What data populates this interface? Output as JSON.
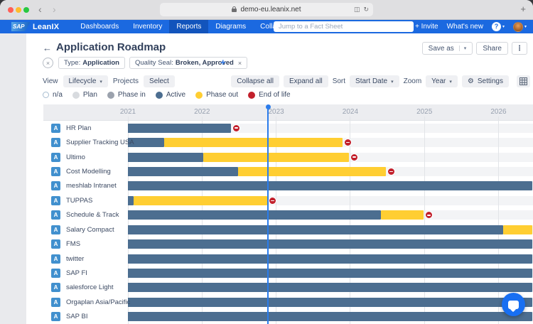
{
  "browser": {
    "url": "demo-eu.leanix.net",
    "traffic_lights": [
      "#ff5f57",
      "#febc2e",
      "#28c840"
    ]
  },
  "icons": {
    "back": "←",
    "caret_down": "▾",
    "kebab": "⋮",
    "gear": "⚙",
    "close": "×",
    "plus": "+",
    "chevron_left": "‹",
    "chevron_right": "›",
    "reload": "↻",
    "tabs": "◫",
    "help": "?"
  },
  "nav": {
    "brand_sap": "SAP",
    "brand_leanix": "LeanIX",
    "items": [
      {
        "label": "Dashboards",
        "active": false
      },
      {
        "label": "Inventory",
        "active": false
      },
      {
        "label": "Reports",
        "active": true
      },
      {
        "label": "Diagrams",
        "active": false
      },
      {
        "label": "Collaboration",
        "active": false
      }
    ],
    "search_placeholder": "Jump to a Fact Sheet",
    "invite_label": "+ Invite",
    "whats_new_label": "What's new"
  },
  "header": {
    "title": "Application Roadmap",
    "save_as_label": "Save as",
    "share_label": "Share"
  },
  "filters": {
    "chips": [
      {
        "prefix": "Type:",
        "value": "Application",
        "removable": false
      },
      {
        "prefix": "Quality Seal:",
        "value": "Broken, Approved",
        "removable": true
      }
    ]
  },
  "toolbar": {
    "view_label": "View",
    "view_value": "Lifecycle",
    "projects_label": "Projects",
    "select_label": "Select",
    "collapse_all_label": "Collapse all",
    "expand_all_label": "Expand all",
    "sort_label": "Sort",
    "sort_value": "Start Date",
    "zoom_label": "Zoom",
    "zoom_value": "Year",
    "settings_label": "Settings"
  },
  "legend": [
    {
      "label": "n/a",
      "style": "outline",
      "color": "#ffffff"
    },
    {
      "label": "Plan",
      "style": "fill",
      "color": "#d8dbdf"
    },
    {
      "label": "Phase in",
      "style": "fill",
      "color": "#9ba2ad"
    },
    {
      "label": "Active",
      "style": "fill",
      "color": "#4c6e90"
    },
    {
      "label": "Phase out",
      "style": "fill",
      "color": "#ffce32"
    },
    {
      "label": "End of life",
      "style": "fill",
      "color": "#c2202c"
    }
  ],
  "chart_data": {
    "type": "bar",
    "subtype": "lifecycle-roadmap-gantt",
    "title": "Application Roadmap",
    "x_ticks": [
      2021,
      2022,
      2023,
      2024,
      2025,
      2026
    ],
    "x_range": [
      2020.99,
      2026.46
    ],
    "today": 2022.89,
    "grid": true,
    "phase_colors": {
      "active": "#4c6e90",
      "phase_out": "#ffce32",
      "end_of_life": "#c2202c"
    },
    "rows": [
      {
        "name": "HR Plan",
        "badge": "A",
        "segments": [
          {
            "phase": "active",
            "from": 2020.99,
            "to": 2022.39
          }
        ],
        "end_of_life": true
      },
      {
        "name": "Supplier Tracking USA",
        "badge": "A",
        "segments": [
          {
            "phase": "active",
            "from": 2020.99,
            "to": 2021.49
          },
          {
            "phase": "phase_out",
            "from": 2021.49,
            "to": 2023.9
          }
        ],
        "end_of_life": true
      },
      {
        "name": "Ultimo",
        "badge": "A",
        "segments": [
          {
            "phase": "active",
            "from": 2020.99,
            "to": 2022.02
          },
          {
            "phase": "phase_out",
            "from": 2022.02,
            "to": 2023.98
          }
        ],
        "end_of_life": true
      },
      {
        "name": "Cost Modelling",
        "badge": "A",
        "segments": [
          {
            "phase": "active",
            "from": 2020.99,
            "to": 2022.49
          },
          {
            "phase": "phase_out",
            "from": 2022.49,
            "to": 2024.48
          }
        ],
        "end_of_life": true
      },
      {
        "name": "meshlab Intranet",
        "badge": "A",
        "segments": [
          {
            "phase": "active",
            "from": 2020.99,
            "to": 2026.46
          }
        ],
        "end_of_life": false
      },
      {
        "name": "TUPPAS",
        "badge": "A",
        "segments": [
          {
            "phase": "active",
            "from": 2020.99,
            "to": 2021.08
          },
          {
            "phase": "phase_out",
            "from": 2021.08,
            "to": 2022.88
          }
        ],
        "end_of_life": true
      },
      {
        "name": "Schedule & Track",
        "badge": "A",
        "segments": [
          {
            "phase": "active",
            "from": 2020.99,
            "to": 2024.41
          },
          {
            "phase": "phase_out",
            "from": 2024.41,
            "to": 2024.99
          }
        ],
        "end_of_life": true
      },
      {
        "name": "Salary Compact",
        "badge": "A",
        "segments": [
          {
            "phase": "active",
            "from": 2020.99,
            "to": 2026.06
          },
          {
            "phase": "phase_out",
            "from": 2026.06,
            "to": 2026.46
          }
        ],
        "end_of_life": false
      },
      {
        "name": "FMS",
        "badge": "A",
        "segments": [
          {
            "phase": "active",
            "from": 2020.99,
            "to": 2026.46
          }
        ],
        "end_of_life": false
      },
      {
        "name": "twitter",
        "badge": "A",
        "segments": [
          {
            "phase": "active",
            "from": 2020.99,
            "to": 2026.46
          }
        ],
        "end_of_life": false
      },
      {
        "name": "SAP FI",
        "badge": "A",
        "segments": [
          {
            "phase": "active",
            "from": 2020.99,
            "to": 2026.46
          }
        ],
        "end_of_life": false
      },
      {
        "name": "salesforce Light",
        "badge": "A",
        "segments": [
          {
            "phase": "active",
            "from": 2020.99,
            "to": 2026.46
          }
        ],
        "end_of_life": false
      },
      {
        "name": "Orgaplan Asia/Pacific",
        "badge": "A",
        "segments": [
          {
            "phase": "active",
            "from": 2020.99,
            "to": 2026.46
          }
        ],
        "end_of_life": false
      },
      {
        "name": "SAP BI",
        "badge": "A",
        "segments": [
          {
            "phase": "active",
            "from": 2020.99,
            "to": 2026.46
          }
        ],
        "end_of_life": false
      }
    ]
  },
  "colors": {
    "nav_bg": "#1b69e0",
    "nav_active_bg": "#1254bc",
    "accent_blue": "#2e77e5",
    "today_line": "#2b7ceb",
    "badge_blue": "#4190ce",
    "header_band": "#ecedf0",
    "row_track": "#f3f4f6"
  }
}
